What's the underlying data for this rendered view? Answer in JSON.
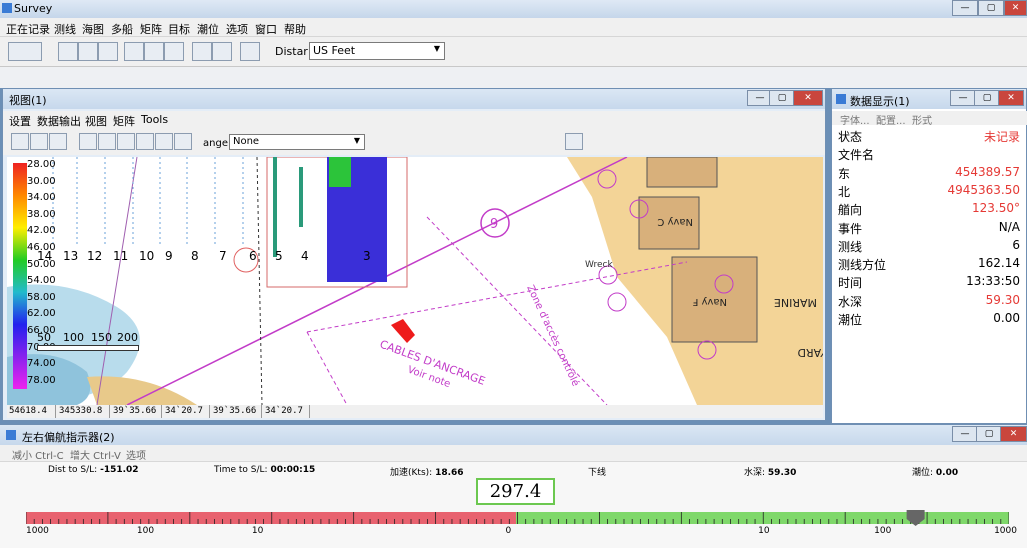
{
  "app": {
    "title": "Survey"
  },
  "menubar": [
    "正在记录",
    "测线",
    "海图",
    "多船",
    "矩阵",
    "目标",
    "潮位",
    "选项",
    "窗口",
    "帮助"
  ],
  "toolbar": {
    "distance_label": "Distar",
    "distance_value": "US Feet"
  },
  "view_window": {
    "title": "视图(1)",
    "menu": [
      "设置",
      "数据输出",
      "视图",
      "矩阵",
      "Tools"
    ],
    "range_label": "ange",
    "range_value": "None",
    "depth_scale": [
      "28.00",
      "30.00",
      "34.00",
      "38.00",
      "42.00",
      "46.00",
      "50.00",
      "54.00",
      "58.00",
      "62.00",
      "66.00",
      "70.00",
      "74.00",
      "78.00"
    ],
    "line_numbers": [
      "14",
      "13",
      "12",
      "11",
      "10",
      "9",
      "8",
      "7",
      "6",
      "5",
      "4",
      "3"
    ],
    "scale_bar": [
      "50",
      "100",
      "150",
      "200"
    ],
    "chart_labels": [
      "CABLES D'ANCRAGE",
      "Zone d'accès contrôlé",
      "Voir note",
      "Navy C",
      "Navy F",
      "Wreck",
      "MARINE",
      "YARD",
      "9"
    ],
    "coords": [
      "54618.4",
      "345330.8",
      "39`35.66",
      "34`20.7",
      "39`35.66",
      "34`20.7"
    ]
  },
  "data_window": {
    "title": "数据显示(1)",
    "submenu": [
      "字体...",
      "配置...",
      "形式"
    ],
    "rows": [
      {
        "label": "状态",
        "value": "未记录",
        "color": "#e53935"
      },
      {
        "label": "文件名",
        "value": "",
        "color": "#000000"
      },
      {
        "label": "东",
        "value": "454389.57",
        "color": "#e53935"
      },
      {
        "label": "北",
        "value": "4945363.50",
        "color": "#e53935"
      },
      {
        "label": "艏向",
        "value": "123.50°",
        "color": "#e53935"
      },
      {
        "label": "事件",
        "value": "N/A",
        "color": "#000000"
      },
      {
        "label": "测线",
        "value": "6",
        "color": "#000000"
      },
      {
        "label": "测线方位",
        "value": "162.14",
        "color": "#000000"
      },
      {
        "label": "时间",
        "value": "13:33:50",
        "color": "#000000"
      },
      {
        "label": "水深",
        "value": "59.30",
        "color": "#e53935"
      },
      {
        "label": "潮位",
        "value": "0.00",
        "color": "#000000"
      }
    ]
  },
  "indicator_window": {
    "title": "左右偏航指示器(2)",
    "submenu": [
      "减小 Ctrl-C",
      "增大 Ctrl-V",
      "选项"
    ],
    "metrics": [
      {
        "label": "Dist to S/L:",
        "value": "-151.02"
      },
      {
        "label": "Time to S/L:",
        "value": "00:00:15"
      },
      {
        "label": "加速(Kts):",
        "value": "18.66"
      },
      {
        "label": "下线",
        "value": ""
      },
      {
        "label": "水深:",
        "value": "59.30"
      },
      {
        "label": "潮位:",
        "value": "0.00"
      }
    ],
    "offset_value": "297.4",
    "scale_labels": [
      "1000",
      "100",
      "10",
      "0",
      "10",
      "100",
      "1000"
    ],
    "pointer_position": 0.905
  },
  "colors": {
    "left_bar": "#e8626f",
    "right_bar": "#7fd86a",
    "accent": "#e53935"
  }
}
